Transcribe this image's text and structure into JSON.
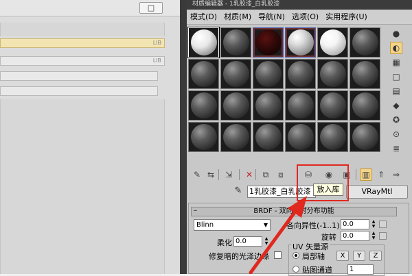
{
  "left_panel": {
    "close_label": "□",
    "rows": [
      {
        "label": "LIB",
        "selected": true
      },
      {
        "label": "LIB",
        "selected": false
      },
      {
        "label": "",
        "selected": false
      },
      {
        "label": "",
        "selected": false
      }
    ]
  },
  "editor": {
    "title": "材质编辑器 - 1乳胶漆_白乳胶漆",
    "menu": [
      "模式(D)",
      "材质(M)",
      "导航(N)",
      "选项(O)",
      "实用程序(U)"
    ],
    "sample_slots": [
      {
        "style": "white",
        "active": true
      },
      {
        "style": "default"
      },
      {
        "style": "dark-red",
        "hot": true
      },
      {
        "style": "lit",
        "hot": true
      },
      {
        "style": "bright"
      },
      {
        "style": "default"
      }
    ],
    "material_name": "1乳胶漆_白乳胶漆",
    "material_type": "VRayMtl",
    "tooltip": "放入库",
    "vertical_tools": [
      {
        "icon": "sphere-type-icon",
        "glyph": "●",
        "on": false
      },
      {
        "icon": "backlight-icon",
        "glyph": "◐",
        "on": true
      },
      {
        "icon": "background-icon",
        "glyph": "▦",
        "on": false
      },
      {
        "icon": "sample-uv-icon",
        "glyph": "□",
        "on": false
      },
      {
        "icon": "video-color-icon",
        "glyph": "▤",
        "on": false
      },
      {
        "icon": "make-preview-icon",
        "glyph": "◆",
        "on": false
      },
      {
        "icon": "options-icon",
        "glyph": "✪",
        "on": false
      },
      {
        "icon": "select-by-material-icon",
        "glyph": "⊙",
        "on": false
      },
      {
        "icon": "material-navigator-icon",
        "glyph": "≣",
        "on": false
      }
    ],
    "horizontal_tools": [
      {
        "icon": "get-material-icon",
        "glyph": "✎"
      },
      {
        "icon": "put-to-scene-icon",
        "glyph": "⇆"
      },
      {
        "icon": "assign-to-selection-icon",
        "glyph": "⇲"
      },
      {
        "icon": "reset-map-icon",
        "glyph": "✕",
        "red": true
      },
      {
        "icon": "make-copy-icon",
        "glyph": "⧉"
      },
      {
        "icon": "make-unique-icon",
        "glyph": "⧈"
      },
      {
        "icon": "put-to-library-icon",
        "glyph": "⛁"
      },
      {
        "icon": "material-id-icon",
        "glyph": "◉"
      },
      {
        "icon": "show-in-viewport-icon",
        "glyph": "▣"
      },
      {
        "icon": "show-end-result-icon",
        "glyph": "▥",
        "on": true
      },
      {
        "icon": "go-to-parent-icon",
        "glyph": "⇑"
      },
      {
        "icon": "go-forward-icon",
        "glyph": "⇒"
      }
    ],
    "brdf": {
      "header": "BRDF - 双向反射分布功能",
      "type_value": "Blinn",
      "soften_label": "柔化",
      "soften_value": "0.0",
      "fix_dark_label": "修复暗的光泽边缘",
      "anisotropy_label": "各向异性(-1..1)",
      "anisotropy_value": "0.0",
      "rotation_label": "旋转",
      "rotation_value": "0.0",
      "uv_group_label": "UV 矢量源",
      "local_axis_label": "局部轴",
      "axes": [
        "X",
        "Y",
        "Z"
      ],
      "map_channel_label": "贴图通道",
      "map_channel_value": "1"
    }
  }
}
